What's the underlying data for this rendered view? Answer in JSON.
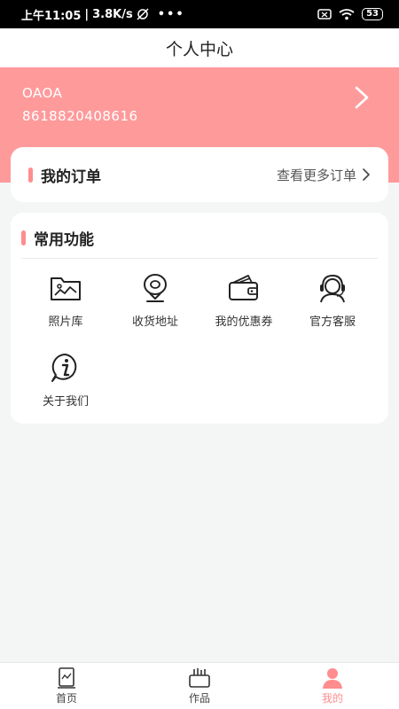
{
  "status_bar": {
    "time": "上午11:05",
    "speed": "3.8K/s",
    "battery": "53"
  },
  "header": {
    "title": "个人中心"
  },
  "profile": {
    "username": "OAOA",
    "phone": "8618820408616"
  },
  "orders": {
    "title": "我的订单",
    "more_label": "查看更多订单"
  },
  "functions": {
    "title": "常用功能",
    "items": [
      {
        "label": "照片库",
        "icon": "photo-library-icon"
      },
      {
        "label": "收货地址",
        "icon": "location-pin-icon"
      },
      {
        "label": "我的优惠券",
        "icon": "wallet-icon"
      },
      {
        "label": "官方客服",
        "icon": "customer-service-icon"
      },
      {
        "label": "关于我们",
        "icon": "info-icon"
      }
    ]
  },
  "tabs": [
    {
      "label": "首页",
      "icon": "home-book-icon",
      "active": false
    },
    {
      "label": "作品",
      "icon": "works-box-icon",
      "active": false
    },
    {
      "label": "我的",
      "icon": "profile-person-icon",
      "active": true
    }
  ],
  "colors": {
    "accent": "#ff8c8e",
    "profile_bg": "#ff9a9b",
    "page_bg": "#f4f5f5"
  }
}
